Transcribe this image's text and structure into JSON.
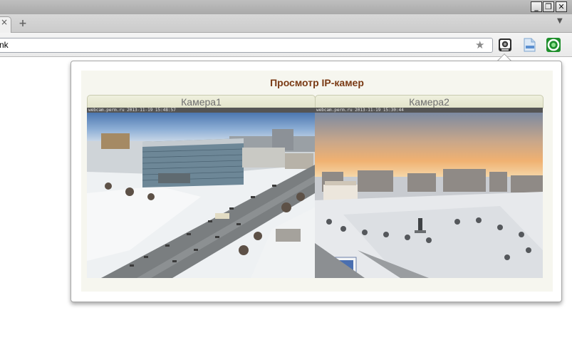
{
  "window": {
    "minimize_label": "_",
    "restore_label": "❐",
    "close_label": "✕"
  },
  "tabs": {
    "close_label": "×",
    "new_tab_label": "+",
    "menu_label": "▼"
  },
  "address_bar": {
    "value": "nk",
    "star_icon": "star-icon"
  },
  "extensions": [
    "webcam-extension-icon",
    "document-extension-icon",
    "green-circle-extension-icon"
  ],
  "popup": {
    "title": "Просмотр IP-камер",
    "cameras": [
      {
        "label": "Камера1",
        "stamp": "webcam.perm.ru 2013-11-19 15:48:57"
      },
      {
        "label": "Камера2",
        "stamp": "webcam.perm.ru 2013-11-19 15:30:44"
      }
    ]
  }
}
